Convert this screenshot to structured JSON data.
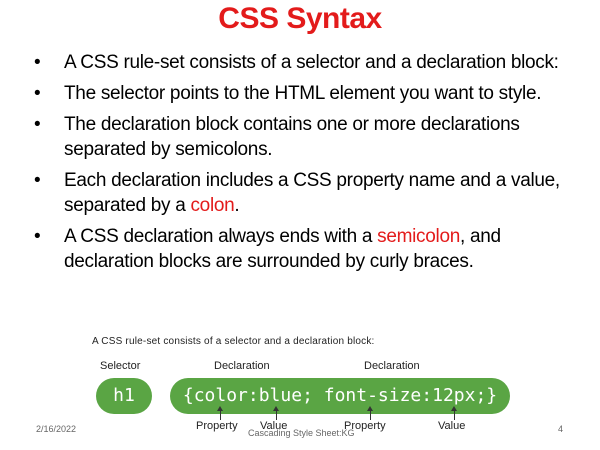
{
  "slide": {
    "title": "CSS Syntax",
    "bullets": [
      {
        "parts": [
          {
            "text": "A CSS rule-set consists of a selector and a declaration block:"
          }
        ]
      },
      {
        "parts": [
          {
            "text": "The selector points to the HTML element you want to style."
          }
        ]
      },
      {
        "parts": [
          {
            "text": "The declaration block contains one or more declarations separated by semicolons."
          }
        ]
      },
      {
        "parts": [
          {
            "text": "Each declaration includes a CSS property name and a value, separated by a "
          },
          {
            "text": "colon",
            "color": "#e31b1b"
          },
          {
            "text": "."
          }
        ]
      },
      {
        "parts": [
          {
            "text": "A CSS declaration always ends with a "
          },
          {
            "text": "semicolon",
            "color": "#e31b1b"
          },
          {
            "text": ", and declaration blocks are surrounded by curly braces."
          }
        ]
      }
    ],
    "bullet_symbol": "•",
    "accent_color": "#e31b1b"
  },
  "diagram": {
    "caption": "A CSS rule-set consists of a selector and a declaration block:",
    "selector_label": "Selector",
    "declaration_label_1": "Declaration",
    "declaration_label_2": "Declaration",
    "selector_code": "h1",
    "declaration_code": "{color:blue; font-size:12px;}",
    "property_label_1": "Property",
    "value_label_1": "Value",
    "property_label_2": "Property",
    "value_label_2": "Value",
    "pill_color": "#5aa544"
  },
  "footer": {
    "date": "2/16/2022",
    "center": "Cascading Style Sheet:KG",
    "page": "4"
  }
}
